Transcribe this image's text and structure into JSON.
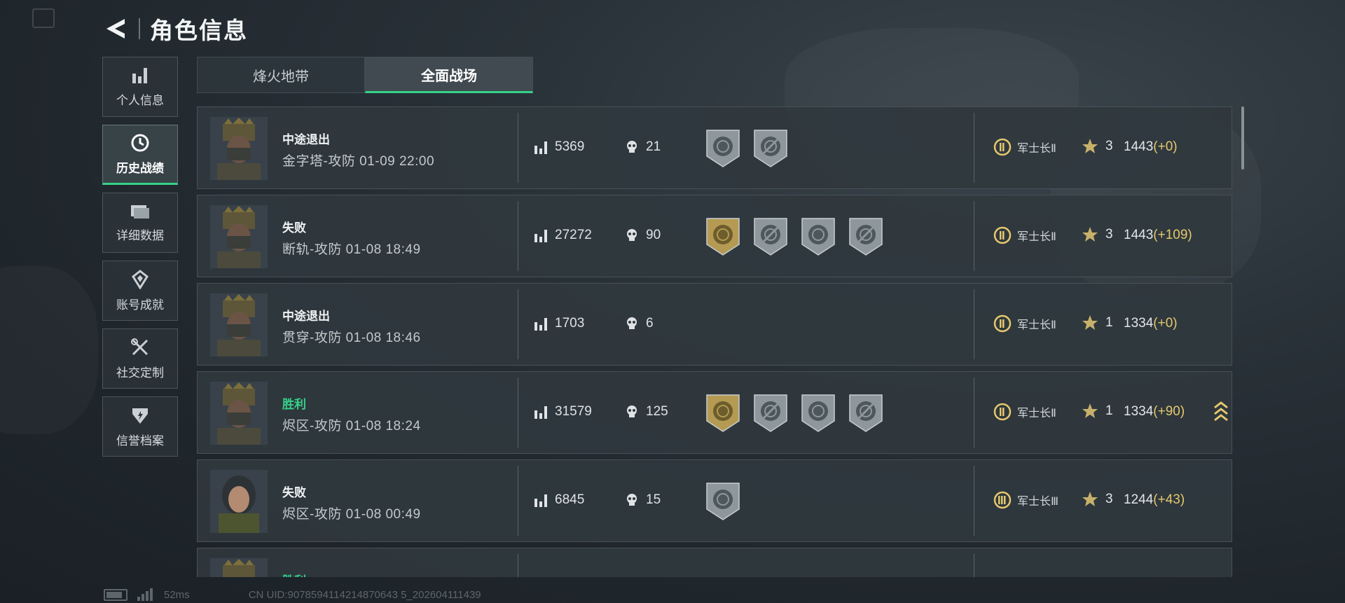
{
  "header": {
    "title": "角色信息"
  },
  "sidebar": {
    "items": [
      {
        "label": "个人信息",
        "icon": "bar-chart-icon"
      },
      {
        "label": "历史战绩",
        "icon": "clock-icon",
        "active": true
      },
      {
        "label": "详细数据",
        "icon": "folder-icon"
      },
      {
        "label": "账号成就",
        "icon": "achievement-icon"
      },
      {
        "label": "社交定制",
        "icon": "tools-icon"
      },
      {
        "label": "信誉档案",
        "icon": "shield-icon"
      }
    ]
  },
  "tabs": [
    {
      "label": "烽火地带"
    },
    {
      "label": "全面战场",
      "active": true
    }
  ],
  "matches": [
    {
      "result": "中途退出",
      "map": "金字塔-攻防 01-09 22:00",
      "score": "5369",
      "kills": "21",
      "medals": [
        "grey",
        "grey"
      ],
      "rank_label": "军士长Ⅱ",
      "stars": "3",
      "elo": "1443",
      "delta": "(+0)"
    },
    {
      "result": "失败",
      "map": "断轨-攻防 01-08 18:49",
      "score": "27272",
      "kills": "90",
      "medals": [
        "gold",
        "grey",
        "grey",
        "grey"
      ],
      "rank_label": "军士长Ⅱ",
      "stars": "3",
      "elo": "1443",
      "delta": "(+109)"
    },
    {
      "result": "中途退出",
      "map": "贯穿-攻防 01-08 18:46",
      "score": "1703",
      "kills": "6",
      "medals": [],
      "rank_label": "军士长Ⅱ",
      "stars": "1",
      "elo": "1334",
      "delta": "(+0)"
    },
    {
      "result": "胜利",
      "map": "烬区-攻防 01-08 18:24",
      "score": "31579",
      "kills": "125",
      "medals": [
        "gold",
        "grey",
        "grey",
        "grey"
      ],
      "rank_label": "军士长Ⅱ",
      "stars": "1",
      "elo": "1334",
      "delta": "(+90)",
      "promoted": true
    },
    {
      "result": "失败",
      "map": "烬区-攻防 01-08 00:49",
      "score": "6845",
      "kills": "15",
      "medals": [
        "grey"
      ],
      "rank_label": "军士长Ⅲ",
      "stars": "3",
      "elo": "1244",
      "delta": "(+43)"
    },
    {
      "result": "胜利",
      "map": "",
      "score": "",
      "kills": "",
      "medals": [],
      "rank_label": "",
      "stars": "",
      "elo": "",
      "delta": ""
    }
  ],
  "footer": {
    "ping": "52ms",
    "uid": "CN UID:9078594114214870643 5_202604111439"
  },
  "colors": {
    "accent": "#35d28a",
    "gold": "#e5c86d",
    "win": "#35d28a"
  }
}
